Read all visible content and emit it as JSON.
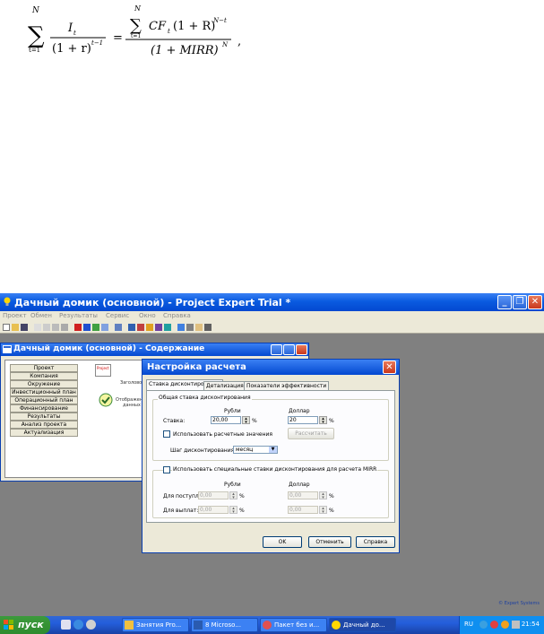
{
  "formula": {
    "sum_sym": "∑",
    "lhs_top": "N",
    "lhs_bottom": "t=1",
    "lhs_num": "I",
    "lhs_num_sub": "t",
    "lhs_den": "(1 + r)",
    "lhs_den_exp": "t−1",
    "equals": "=",
    "rhs_num": "CF",
    "rhs_num_sub": "t",
    "rhs_num_rest": "(1 + R)",
    "rhs_num_exp": "N−t",
    "rhs_den": "(1 + MIRR)",
    "rhs_den_exp": "N",
    "comma": ","
  },
  "window": {
    "title": "Дачный домик (основной) - Project Expert Trial *",
    "minimize": "_",
    "maximize": "❐",
    "close": "✕"
  },
  "menu": [
    "Проект",
    "Обмен",
    "Результаты",
    "Сервис",
    "Окно",
    "Справка"
  ],
  "child": {
    "title": "Дачный домик (основной) - Содержание",
    "nav": [
      "Проект",
      "Компания",
      "Окружение",
      "Инвестиционный план",
      "Операционный план",
      "Финансирование",
      "Результаты",
      "Анализ проекта",
      "Актуализация"
    ],
    "doc1_tag": "Project",
    "doc1_label": "Заголовок",
    "doc2_label_1": "Отображение",
    "doc2_label_2": "данных"
  },
  "dialog": {
    "title": "Настройка расчета",
    "close": "✕",
    "tabs": [
      "Ставка дисконтирования",
      "Детализация",
      "Показатели эффективности"
    ],
    "group1_label": "Общая ставка дисконтирования",
    "col_rub": "Рубли",
    "col_usd": "Доллар",
    "rate_label": "Ставка:",
    "rate_rub": "20,00",
    "rate_usd": "20",
    "percent": "%",
    "use_calc_label": "Использовать расчетные значения",
    "calc_button": "Рассчитать",
    "step_label": "Шаг дисконтирования:",
    "step_value": "месяц",
    "group2_label": "Использовать специальные ставки дисконтирования для расчета MIRR",
    "col_rub2": "Рубли",
    "col_usd2": "Доллар",
    "income_label": "Для поступлений:",
    "income_rub": "0,00",
    "income_usd": "0,00",
    "pay_label": "Для выплат:",
    "pay_rub": "0,00",
    "pay_usd": "0,00",
    "ok": "OK",
    "cancel": "Отменить",
    "help": "Справка"
  },
  "brand_footer": "© Expert Systems",
  "taskbar": {
    "start": "пуск",
    "tasks": [
      "Занятия Pro...",
      "8 Microso...",
      "Пакет без и...",
      "Дачный до..."
    ],
    "lang": "RU",
    "time": "21:54"
  },
  "colors": {
    "xp_blue": "#0a5be0",
    "start_green": "#2e8b2e",
    "close_red": "#c9381d",
    "dialog_bg": "#ece9d8"
  }
}
